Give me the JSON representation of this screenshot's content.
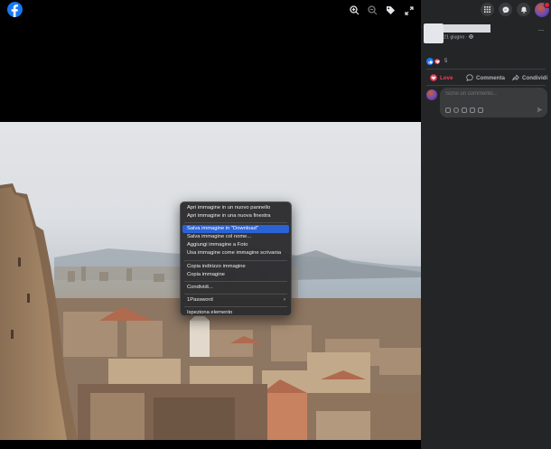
{
  "viewer": {
    "icons": [
      "facebook-logo",
      "zoom-in-icon",
      "zoom-out-icon",
      "tag-icon",
      "fullscreen-icon"
    ]
  },
  "context_menu": {
    "items": [
      {
        "label": "Apri immagine in un nuovo pannello",
        "highlighted": false
      },
      {
        "label": "Apri immagine in una nuova finestra",
        "highlighted": false
      },
      {
        "label": "Salva immagine in \"Download\"",
        "highlighted": true
      },
      {
        "label": "Salva immagine col nome...",
        "highlighted": false
      },
      {
        "label": "Aggiungi immagine a Foto",
        "highlighted": false
      },
      {
        "label": "Usa immagine come immagine scrivania",
        "highlighted": false
      },
      {
        "label": "Copia indirizzo immagine",
        "highlighted": false
      },
      {
        "label": "Copia immagine",
        "highlighted": false
      },
      {
        "label": "Condividi...",
        "highlighted": false
      },
      {
        "label": "1Password",
        "highlighted": false,
        "submenu": true
      },
      {
        "label": "Ispeziona elemento",
        "highlighted": false
      }
    ],
    "submenu_arrow": "›",
    "highlight_color": "#2b62d6"
  },
  "sidebar": {
    "top_icons": [
      "menu-grid-icon",
      "messenger-icon",
      "notifications-bell-icon",
      "profile-avatar"
    ],
    "post": {
      "date": "21 giugno · ",
      "more": "···"
    },
    "reactions": {
      "count": "5"
    },
    "actions": {
      "love": "Love",
      "comment": "Commenta",
      "share": "Condividi"
    },
    "comment": {
      "placeholder": "Scrivi un commento..."
    },
    "colors": {
      "panel_bg": "#242526",
      "love": "#f33e58",
      "like": "#1877f2",
      "facebook_blue": "#1877f2"
    }
  }
}
